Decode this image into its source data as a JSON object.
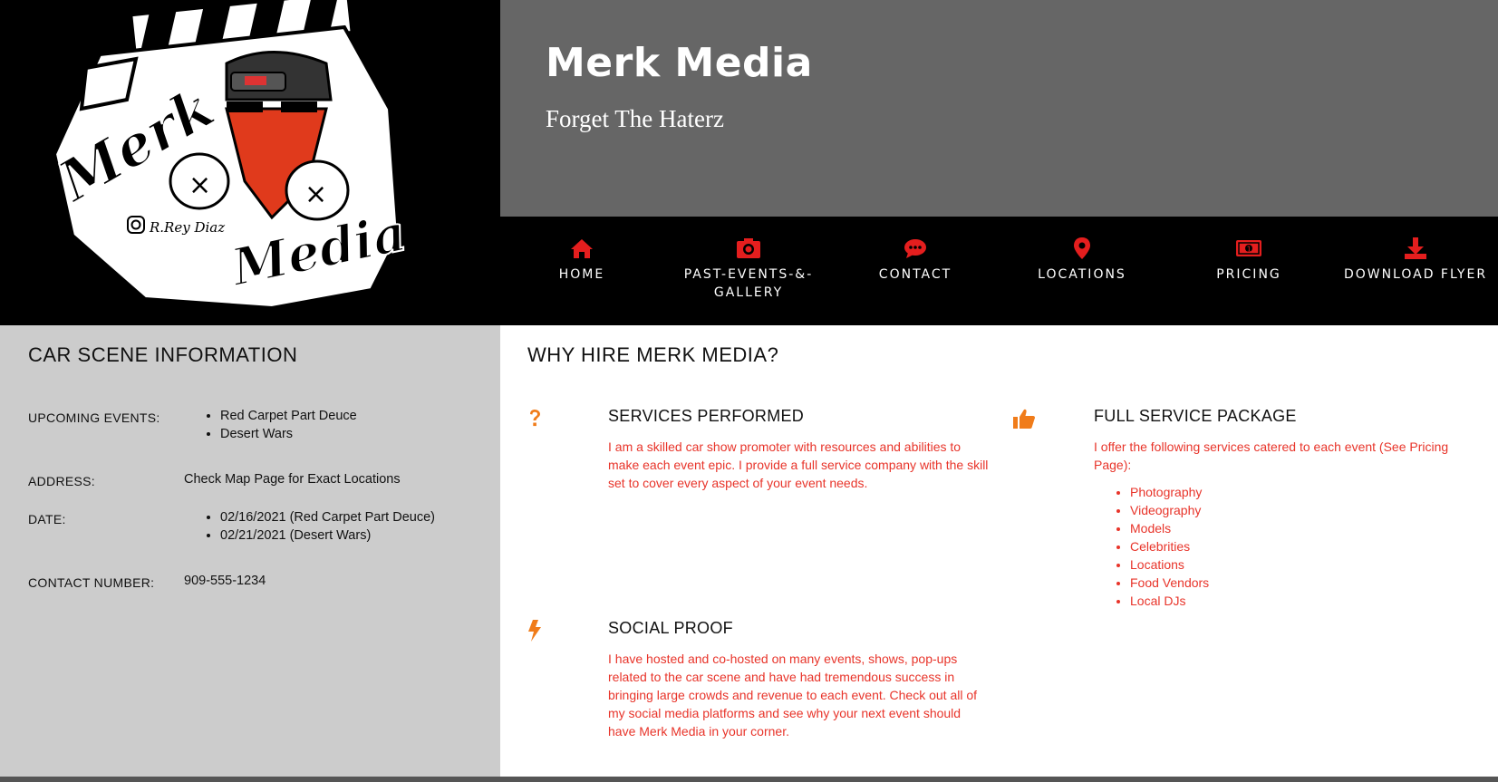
{
  "header": {
    "title": "Merk Media",
    "tagline": "Forget The Haterz"
  },
  "logo": {
    "lettering_top": "Merk",
    "lettering_bottom": "Media",
    "signature": "R.Rey Diaz"
  },
  "nav": {
    "items": [
      {
        "label": "HOME",
        "icon": "home-icon"
      },
      {
        "label": "PAST-EVENTS-&-GALLERY",
        "icon": "camera-icon"
      },
      {
        "label": "CONTACT",
        "icon": "chat-icon"
      },
      {
        "label": "LOCATIONS",
        "icon": "map-marker-icon"
      },
      {
        "label": "PRICING",
        "icon": "money-icon"
      },
      {
        "label": "DOWNLOAD FLYER",
        "icon": "download-icon"
      }
    ]
  },
  "sidebar": {
    "heading": "CAR SCENE INFORMATION",
    "upcoming_label": "UPCOMING EVENTS:",
    "upcoming_events": [
      "Red Carpet Part Deuce",
      "Desert Wars"
    ],
    "address_label": "ADDRESS:",
    "address_value": "Check Map Page for Exact Locations",
    "date_label": "DATE:",
    "dates": [
      "02/16/2021 (Red Carpet Part Deuce)",
      "02/21/2021 (Desert Wars)"
    ],
    "contact_label": "CONTACT NUMBER:",
    "contact_value": "909-555-1234"
  },
  "main": {
    "heading": "WHY HIRE MERK MEDIA?",
    "services": {
      "icon": "question-icon",
      "title": "SERVICES PERFORMED",
      "text": "I am a skilled car show promoter with resources and abilities to make each event epic. I provide a full service company with the skill set to cover every aspect of your event needs."
    },
    "package": {
      "icon": "thumbs-up-icon",
      "title": "FULL SERVICE PACKAGE",
      "text": "I offer the following services catered to each event (See Pricing Page):",
      "items": [
        "Photography",
        "Videography",
        "Models",
        "Celebrities",
        "Locations",
        "Food Vendors",
        "Local DJs"
      ]
    },
    "social": {
      "icon": "bolt-icon",
      "title": "SOCIAL PROOF",
      "text": "I have hosted and co-hosted on many events, shows, pop-ups related to the car scene and have had tremendous success in bringing large crowds and revenue to each event. Check out all of my social media platforms and see why your next event should have Merk Media in your corner."
    }
  },
  "colors": {
    "accent_red": "#e8342a",
    "icon_red": "#e41e1e",
    "icon_orange": "#f07c1a",
    "header_gray": "#666666",
    "sidebar_gray": "#cccccc"
  }
}
